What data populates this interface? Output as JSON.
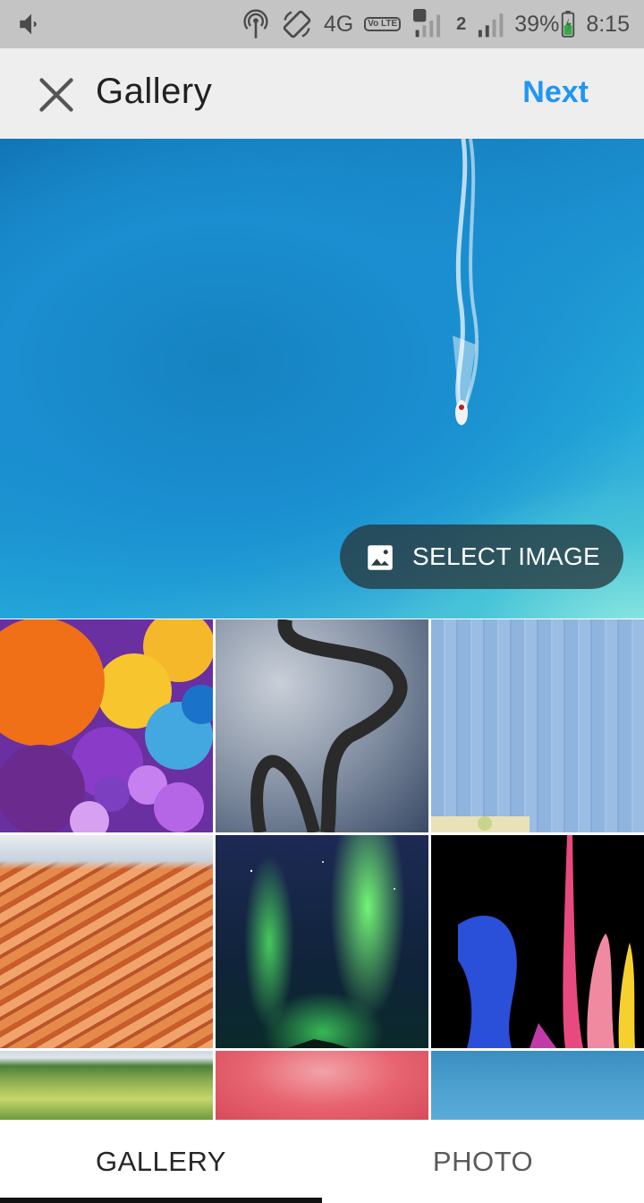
{
  "status_bar": {
    "network": "4G",
    "volte": "Vo LTE",
    "sim1": "1",
    "sim2": "2",
    "battery": "39%",
    "time": "8:15",
    "icons": [
      "volume-icon",
      "hotspot-icon",
      "screen-rotate-icon",
      "signal-icon",
      "battery-icon"
    ]
  },
  "app_bar": {
    "title": "Gallery",
    "next_label": "Next",
    "next_color": "#2196f3"
  },
  "preview": {
    "select_label": "SELECT IMAGE"
  },
  "grid": {
    "thumbnails": [
      "balloons",
      "winding-road",
      "blue-wall",
      "canyon",
      "aurora",
      "paint-splash",
      "green-fields",
      "pink-blur",
      "blue-sky"
    ]
  },
  "tabs": [
    {
      "label": "GALLERY",
      "active": true
    },
    {
      "label": "PHOTO",
      "active": false
    }
  ]
}
